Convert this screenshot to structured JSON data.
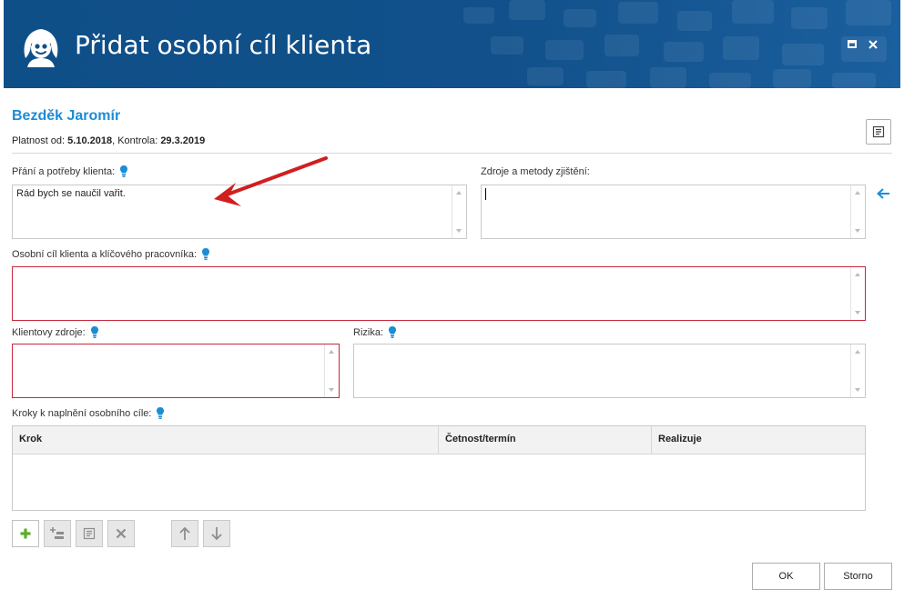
{
  "window": {
    "title": "Přidat osobní cíl klienta"
  },
  "client": {
    "name": "Bezděk Jaromír",
    "validity_label": "Platnost od:",
    "validity_from": "5.10.2018",
    "control_label": "Kontrola:",
    "control_date": "29.3.2019"
  },
  "fields": {
    "wishes": {
      "label": "Přání a potřeby klienta:",
      "value": "Rád bych se naučil vařit."
    },
    "sources": {
      "label": "Zdroje a metody zjištění:",
      "value": ""
    },
    "goal": {
      "label": "Osobní cíl klienta a klíčového pracovníka:",
      "value": ""
    },
    "client_resources": {
      "label": "Klientovy zdroje:",
      "value": ""
    },
    "risks": {
      "label": "Rizika:",
      "value": ""
    },
    "steps": {
      "label": "Kroky k naplnění osobního cíle:"
    }
  },
  "steps_table": {
    "columns": [
      "Krok",
      "Četnost/termín",
      "Realizuje"
    ],
    "rows": []
  },
  "toolbar": {
    "add": "plus-icon",
    "add_sub": "add-sub-icon",
    "edit": "edit-icon",
    "delete": "delete-icon",
    "move_up": "arrow-up-icon",
    "move_down": "arrow-down-icon"
  },
  "buttons": {
    "ok": "OK",
    "cancel": "Storno"
  },
  "colors": {
    "title_bar": "#11508a",
    "accent": "#1a8dd6",
    "required_border": "#c8283a",
    "annotation_arrow": "#d01f1f",
    "add_icon": "#5aae27"
  }
}
